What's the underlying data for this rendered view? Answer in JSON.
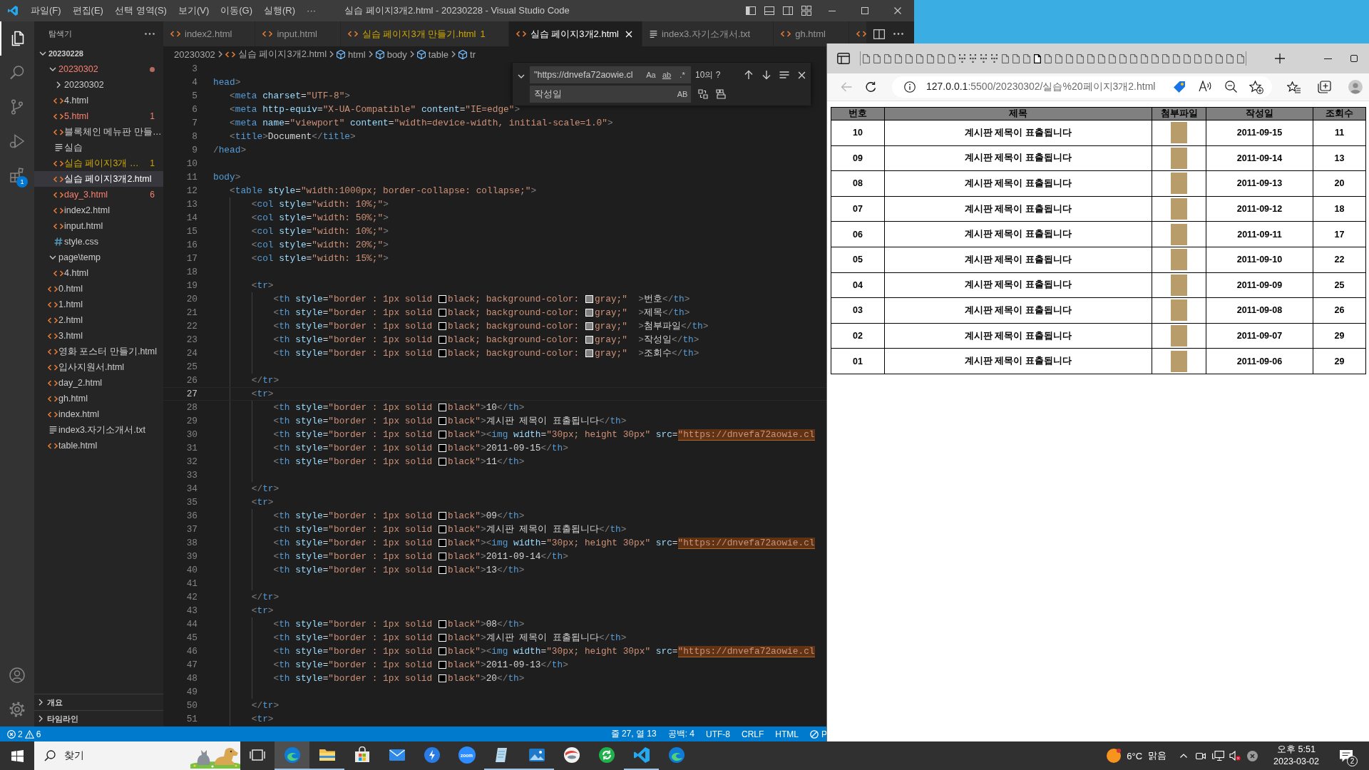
{
  "vscode": {
    "menu": [
      "파일(F)",
      "편집(E)",
      "선택 영역(S)",
      "보기(V)",
      "이동(G)",
      "실행(R)",
      "···"
    ],
    "title": "실습 페이지3개2.html - 20230228 - Visual Studio Code",
    "activity": [
      {
        "kind": "explorer",
        "selected": true
      },
      {
        "kind": "search",
        "selected": false
      },
      {
        "kind": "source-control",
        "selected": false
      },
      {
        "kind": "run",
        "selected": false
      },
      {
        "kind": "extensions",
        "selected": false,
        "badge": "1"
      }
    ],
    "activity_bottom": [
      {
        "kind": "account"
      },
      {
        "kind": "settings"
      }
    ],
    "sidebar": {
      "title": "탐색기",
      "tree": [
        {
          "label": "20230228",
          "kind": "root",
          "expanded": true,
          "selected": false,
          "error": false,
          "warning": false,
          "children": [
            {
              "label": "20230302",
              "kind": "folder",
              "expanded": true,
              "selected": false,
              "error": true,
              "warning": false,
              "children": [
                {
                  "label": "20230302",
                  "kind": "folder",
                  "expanded": false,
                  "selected": false,
                  "error": false,
                  "warning": false
                },
                {
                  "label": "4.html",
                  "kind": "html",
                  "selected": false,
                  "error": false,
                  "warning": false
                },
                {
                  "label": "5.html",
                  "kind": "html",
                  "selected": false,
                  "error": true,
                  "warning": false,
                  "badge": "1"
                },
                {
                  "label": "블록체인 메뉴판 만들…",
                  "kind": "html",
                  "selected": false,
                  "error": false,
                  "warning": false
                },
                {
                  "label": "실습",
                  "kind": "text",
                  "selected": false,
                  "error": false,
                  "warning": false
                },
                {
                  "label": "실습 페이지3개 …",
                  "kind": "html",
                  "selected": false,
                  "error": false,
                  "warning": true,
                  "badge": "1"
                },
                {
                  "label": "실습 페이지3개2.html",
                  "kind": "html",
                  "selected": true,
                  "error": false,
                  "warning": false
                },
                {
                  "label": "day_3.html",
                  "kind": "html",
                  "selected": false,
                  "error": true,
                  "warning": false,
                  "badge": "6"
                },
                {
                  "label": "index2.html",
                  "kind": "html",
                  "selected": false,
                  "error": false,
                  "warning": false
                },
                {
                  "label": "input.html",
                  "kind": "html",
                  "selected": false,
                  "error": false,
                  "warning": false
                },
                {
                  "label": "style.css",
                  "kind": "css",
                  "selected": false,
                  "error": false,
                  "warning": false
                }
              ]
            },
            {
              "label": "page\\temp",
              "kind": "folder",
              "expanded": true,
              "selected": false,
              "error": false,
              "warning": false,
              "children": [
                {
                  "label": "4.html",
                  "kind": "html",
                  "selected": false,
                  "error": false,
                  "warning": false
                }
              ]
            },
            {
              "label": "0.html",
              "kind": "html",
              "selected": false,
              "error": false,
              "warning": false
            },
            {
              "label": "1.html",
              "kind": "html",
              "selected": false,
              "error": false,
              "warning": false
            },
            {
              "label": "2.html",
              "kind": "html",
              "selected": false,
              "error": false,
              "warning": false
            },
            {
              "label": "3.html",
              "kind": "html",
              "selected": false,
              "error": false,
              "warning": false
            },
            {
              "label": "영화 포스터 만들기.html",
              "kind": "html",
              "selected": false,
              "error": false,
              "warning": false
            },
            {
              "label": "입사지원서.html",
              "kind": "html",
              "selected": false,
              "error": false,
              "warning": false
            },
            {
              "label": "day_2.html",
              "kind": "html",
              "selected": false,
              "error": false,
              "warning": false
            },
            {
              "label": "gh.html",
              "kind": "html",
              "selected": false,
              "error": false,
              "warning": false
            },
            {
              "label": "index.html",
              "kind": "html",
              "selected": false,
              "error": false,
              "warning": false
            },
            {
              "label": "index3.자기소개서.txt",
              "kind": "text",
              "selected": false,
              "error": false,
              "warning": false
            },
            {
              "label": "table.html",
              "kind": "html",
              "selected": false,
              "error": false,
              "warning": false
            }
          ]
        }
      ],
      "sections": [
        {
          "label": "개요",
          "expanded": false
        },
        {
          "label": "타임라인",
          "expanded": false
        }
      ]
    },
    "tabs": [
      {
        "label": "index2.html",
        "kind": "html",
        "selected": false,
        "error": false,
        "warning": false
      },
      {
        "label": "input.html",
        "kind": "html",
        "selected": false,
        "error": false,
        "warning": false
      },
      {
        "label": "실습 페이지3개 만들기.html",
        "kind": "html",
        "selected": false,
        "error": false,
        "warning": true,
        "badge": "1"
      },
      {
        "label": "실습 페이지3개2.html",
        "kind": "html",
        "selected": true,
        "error": false,
        "warning": false
      },
      {
        "label": "index3.자기소개서.txt",
        "kind": "text",
        "selected": false,
        "error": false,
        "warning": false
      },
      {
        "label": "gh.html",
        "kind": "html",
        "selected": false,
        "error": false,
        "warning": false
      },
      {
        "kind": "html",
        "selected": false
      }
    ],
    "breadcrumbs": [
      {
        "label": "20230302",
        "kind": "folder"
      },
      {
        "label": "실습 페이지3개2.html",
        "kind": "html"
      },
      {
        "label": "html",
        "kind": "element"
      },
      {
        "label": "body",
        "kind": "element"
      },
      {
        "label": "table",
        "kind": "element"
      },
      {
        "label": "tr",
        "kind": "element"
      }
    ],
    "find": {
      "replace_expanded": true,
      "query": "\"https://dnvefa72aowie.cl",
      "options": [
        {
          "kind": "case",
          "label": "Aa",
          "selected": false
        },
        {
          "kind": "word",
          "label": "ab",
          "selected": false
        },
        {
          "kind": "regex",
          "label": ".*",
          "selected": false
        }
      ],
      "count": "10의 ?",
      "replace": "작성일",
      "preserve_case": {
        "label": "AB",
        "selected": false
      }
    },
    "code": {
      "lines": [
        {
          "number": "3",
          "current": false
        },
        {
          "number": "4",
          "current": false,
          "parts": [
            {
              "kind": "code",
              "text": "head>"
            }
          ]
        },
        {
          "number": "5",
          "current": false,
          "parts": [
            {
              "kind": "code",
              "text": "   <meta charset=\"UTF-8\">"
            }
          ]
        },
        {
          "number": "6",
          "current": false,
          "parts": [
            {
              "kind": "code",
              "text": "   <meta http-equiv=\"X-UA-Compatible\" content=\"IE=edge\">"
            }
          ]
        },
        {
          "number": "7",
          "current": false,
          "parts": [
            {
              "kind": "code",
              "text": "   <meta name=\"viewport\" content=\"width=device-width, initial-scale=1.0\">"
            }
          ]
        },
        {
          "number": "8",
          "current": false,
          "parts": [
            {
              "kind": "code",
              "text": "   <title>Document</title>"
            }
          ]
        },
        {
          "number": "9",
          "current": false,
          "parts": [
            {
              "kind": "code",
              "text": "/head>"
            }
          ]
        },
        {
          "number": "10",
          "current": false
        },
        {
          "number": "11",
          "current": false,
          "parts": [
            {
              "kind": "code",
              "text": "body>"
            }
          ]
        },
        {
          "number": "12",
          "current": false,
          "parts": [
            {
              "kind": "code",
              "text": "   <table style=\"width:1000px; border-collapse: collapse;\">"
            }
          ]
        },
        {
          "number": "13",
          "current": false,
          "parts": [
            {
              "kind": "code",
              "text": "       <col style=\"width: 10%;\">"
            }
          ]
        },
        {
          "number": "14",
          "current": false,
          "parts": [
            {
              "kind": "code",
              "text": "       <col style=\"width: 50%;\">"
            }
          ]
        },
        {
          "number": "15",
          "current": false,
          "parts": [
            {
              "kind": "code",
              "text": "       <col style=\"width: 10%;\">"
            }
          ]
        },
        {
          "number": "16",
          "current": false,
          "parts": [
            {
              "kind": "code",
              "text": "       <col style=\"width: 20%;\">"
            }
          ]
        },
        {
          "number": "17",
          "current": false,
          "parts": [
            {
              "kind": "code",
              "text": "       <col style=\"width: 15%;\">"
            }
          ]
        },
        {
          "number": "18",
          "current": false
        },
        {
          "number": "19",
          "current": false,
          "parts": [
            {
              "kind": "code",
              "text": "       <tr>"
            }
          ]
        },
        {
          "number": "20",
          "current": false,
          "parts": [
            {
              "kind": "code",
              "text": "           <th style=\"border : 1px solid "
            },
            {
              "kind": "swatch",
              "color": "#000000"
            },
            {
              "kind": "code",
              "text": "black; background-color: "
            },
            {
              "kind": "swatch",
              "color": "#808080"
            },
            {
              "kind": "code",
              "text": "gray;\"  >번호</th>"
            }
          ]
        },
        {
          "number": "21",
          "current": false,
          "parts": [
            {
              "kind": "code",
              "text": "           <th style=\"border : 1px solid "
            },
            {
              "kind": "swatch",
              "color": "#000000"
            },
            {
              "kind": "code",
              "text": "black; background-color: "
            },
            {
              "kind": "swatch",
              "color": "#808080"
            },
            {
              "kind": "code",
              "text": "gray;\"  >제목</th>"
            }
          ]
        },
        {
          "number": "22",
          "current": false,
          "parts": [
            {
              "kind": "code",
              "text": "           <th style=\"border : 1px solid "
            },
            {
              "kind": "swatch",
              "color": "#000000"
            },
            {
              "kind": "code",
              "text": "black; background-color: "
            },
            {
              "kind": "swatch",
              "color": "#808080"
            },
            {
              "kind": "code",
              "text": "gray;\"  >첨부파일</th>"
            }
          ]
        },
        {
          "number": "23",
          "current": false,
          "parts": [
            {
              "kind": "code",
              "text": "           <th style=\"border : 1px solid "
            },
            {
              "kind": "swatch",
              "color": "#000000"
            },
            {
              "kind": "code",
              "text": "black; background-color: "
            },
            {
              "kind": "swatch",
              "color": "#808080"
            },
            {
              "kind": "code",
              "text": "gray;\"  >작성일</th>"
            }
          ]
        },
        {
          "number": "24",
          "current": false,
          "parts": [
            {
              "kind": "code",
              "text": "           <th style=\"border : 1px solid "
            },
            {
              "kind": "swatch",
              "color": "#000000"
            },
            {
              "kind": "code",
              "text": "black; background-color: "
            },
            {
              "kind": "swatch",
              "color": "#808080"
            },
            {
              "kind": "code",
              "text": "gray;\"  >조회수</th>"
            }
          ]
        },
        {
          "number": "25",
          "current": false
        },
        {
          "number": "26",
          "current": false,
          "parts": [
            {
              "kind": "code",
              "text": "       </tr>"
            }
          ]
        },
        {
          "number": "27",
          "current": true,
          "parts": [
            {
              "kind": "code",
              "text": "       <tr>"
            }
          ]
        },
        {
          "number": "28",
          "current": false,
          "parts": [
            {
              "kind": "code",
              "text": "           <th style=\"border : 1px solid "
            },
            {
              "kind": "swatch",
              "color": "#000000"
            },
            {
              "kind": "code",
              "text": "black\">10</th>"
            }
          ]
        },
        {
          "number": "29",
          "current": false,
          "parts": [
            {
              "kind": "code",
              "text": "           <th style=\"border : 1px solid "
            },
            {
              "kind": "swatch",
              "color": "#000000"
            },
            {
              "kind": "code",
              "text": "black\">계시판 제목이 표출됩니다</th>"
            }
          ]
        },
        {
          "number": "30",
          "current": false,
          "parts": [
            {
              "kind": "code",
              "text": "           <th style=\"border : 1px solid "
            },
            {
              "kind": "swatch",
              "color": "#000000"
            },
            {
              "kind": "code",
              "text": "black\"><img width=\"30px; height 30px\" src="
            },
            {
              "kind": "match",
              "text": "\"https://dnvefa72aowie.cl"
            }
          ]
        },
        {
          "number": "31",
          "current": false,
          "parts": [
            {
              "kind": "code",
              "text": "           <th style=\"border : 1px solid "
            },
            {
              "kind": "swatch",
              "color": "#000000"
            },
            {
              "kind": "code",
              "text": "black\">2011-09-15</th>"
            }
          ]
        },
        {
          "number": "32",
          "current": false,
          "parts": [
            {
              "kind": "code",
              "text": "           <th style=\"border : 1px solid "
            },
            {
              "kind": "swatch",
              "color": "#000000"
            },
            {
              "kind": "code",
              "text": "black\">11</th>"
            }
          ]
        },
        {
          "number": "33",
          "current": false
        },
        {
          "number": "34",
          "current": false,
          "parts": [
            {
              "kind": "code",
              "text": "       </tr>"
            }
          ]
        },
        {
          "number": "35",
          "current": false,
          "parts": [
            {
              "kind": "code",
              "text": "       <tr>"
            }
          ]
        },
        {
          "number": "36",
          "current": false,
          "parts": [
            {
              "kind": "code",
              "text": "           <th style=\"border : 1px solid "
            },
            {
              "kind": "swatch",
              "color": "#000000"
            },
            {
              "kind": "code",
              "text": "black\">09</th>"
            }
          ]
        },
        {
          "number": "37",
          "current": false,
          "parts": [
            {
              "kind": "code",
              "text": "           <th style=\"border : 1px solid "
            },
            {
              "kind": "swatch",
              "color": "#000000"
            },
            {
              "kind": "code",
              "text": "black\">계시판 제목이 표출됩니다</th>"
            }
          ]
        },
        {
          "number": "38",
          "current": false,
          "parts": [
            {
              "kind": "code",
              "text": "           <th style=\"border : 1px solid "
            },
            {
              "kind": "swatch",
              "color": "#000000"
            },
            {
              "kind": "code",
              "text": "black\"><img width=\"30px; height 30px\" src="
            },
            {
              "kind": "match",
              "text": "\"https://dnvefa72aowie.cl"
            }
          ]
        },
        {
          "number": "39",
          "current": false,
          "parts": [
            {
              "kind": "code",
              "text": "           <th style=\"border : 1px solid "
            },
            {
              "kind": "swatch",
              "color": "#000000"
            },
            {
              "kind": "code",
              "text": "black\">2011-09-14</th>"
            }
          ]
        },
        {
          "number": "40",
          "current": false,
          "parts": [
            {
              "kind": "code",
              "text": "           <th style=\"border : 1px solid "
            },
            {
              "kind": "swatch",
              "color": "#000000"
            },
            {
              "kind": "code",
              "text": "black\">13</th>"
            }
          ]
        },
        {
          "number": "41",
          "current": false
        },
        {
          "number": "42",
          "current": false,
          "parts": [
            {
              "kind": "code",
              "text": "       </tr>"
            }
          ]
        },
        {
          "number": "43",
          "current": false,
          "parts": [
            {
              "kind": "code",
              "text": "       <tr>"
            }
          ]
        },
        {
          "number": "44",
          "current": false,
          "parts": [
            {
              "kind": "code",
              "text": "           <th style=\"border : 1px solid "
            },
            {
              "kind": "swatch",
              "color": "#000000"
            },
            {
              "kind": "code",
              "text": "black\">08</th>"
            }
          ]
        },
        {
          "number": "45",
          "current": false,
          "parts": [
            {
              "kind": "code",
              "text": "           <th style=\"border : 1px solid "
            },
            {
              "kind": "swatch",
              "color": "#000000"
            },
            {
              "kind": "code",
              "text": "black\">계시판 제목이 표출됩니다</th>"
            }
          ]
        },
        {
          "number": "46",
          "current": false,
          "parts": [
            {
              "kind": "code",
              "text": "           <th style=\"border : 1px solid "
            },
            {
              "kind": "swatch",
              "color": "#000000"
            },
            {
              "kind": "code",
              "text": "black\"><img width=\"30px; height 30px\" src="
            },
            {
              "kind": "match",
              "text": "\"https://dnvefa72aowie.cl"
            }
          ]
        },
        {
          "number": "47",
          "current": false,
          "parts": [
            {
              "kind": "code",
              "text": "           <th style=\"border : 1px solid "
            },
            {
              "kind": "swatch",
              "color": "#000000"
            },
            {
              "kind": "code",
              "text": "black\">2011-09-13</th>"
            }
          ]
        },
        {
          "number": "48",
          "current": false,
          "parts": [
            {
              "kind": "code",
              "text": "           <th style=\"border : 1px solid "
            },
            {
              "kind": "swatch",
              "color": "#000000"
            },
            {
              "kind": "code",
              "text": "black\">20</th>"
            }
          ]
        },
        {
          "number": "49",
          "current": false
        },
        {
          "number": "50",
          "current": false,
          "parts": [
            {
              "kind": "code",
              "text": "       </tr>"
            }
          ]
        },
        {
          "number": "51",
          "current": false,
          "parts": [
            {
              "kind": "code",
              "text": "       <tr>"
            }
          ]
        }
      ]
    },
    "status_bar": {
      "errors": "2",
      "warnings": "6",
      "items": [
        "줄 27, 열 13",
        "공백: 4",
        "UTF-8",
        "CRLF",
        "HTML"
      ],
      "last": "P"
    }
  },
  "browser": {
    "tabs": [
      {
        "kind": "page",
        "selected": false
      },
      {
        "kind": "page",
        "selected": false
      },
      {
        "kind": "page",
        "selected": false
      },
      {
        "kind": "page",
        "selected": false
      },
      {
        "kind": "page",
        "selected": false
      },
      {
        "kind": "page",
        "selected": false
      },
      {
        "kind": "page",
        "selected": false
      },
      {
        "kind": "page",
        "selected": false
      },
      {
        "kind": "page",
        "selected": false
      },
      {
        "kind": "dotted",
        "selected": false
      },
      {
        "kind": "dotted",
        "selected": false
      },
      {
        "kind": "dotted",
        "selected": false
      },
      {
        "kind": "dotted",
        "selected": false
      },
      {
        "kind": "page",
        "selected": false
      },
      {
        "kind": "page",
        "selected": false
      },
      {
        "kind": "page",
        "selected": false
      },
      {
        "kind": "page",
        "selected": true
      },
      {
        "kind": "page",
        "selected": false
      },
      {
        "kind": "page",
        "selected": false
      },
      {
        "kind": "page",
        "selected": false
      },
      {
        "kind": "page",
        "selected": false
      },
      {
        "kind": "page",
        "selected": false
      },
      {
        "kind": "page",
        "selected": false
      },
      {
        "kind": "page",
        "selected": false
      },
      {
        "kind": "page",
        "selected": false
      },
      {
        "kind": "page",
        "selected": false
      },
      {
        "kind": "page",
        "selected": false
      },
      {
        "kind": "page",
        "selected": false
      },
      {
        "kind": "page",
        "selected": false
      },
      {
        "kind": "page",
        "selected": false
      },
      {
        "kind": "page",
        "selected": false
      },
      {
        "kind": "page",
        "selected": false
      },
      {
        "kind": "page",
        "selected": false
      },
      {
        "kind": "page",
        "selected": false
      },
      {
        "kind": "page",
        "selected": false
      },
      {
        "kind": "page",
        "selected": false
      }
    ],
    "back": {
      "disabled": true
    },
    "url": {
      "host": "127.0.0.1",
      "path": ":5500/20230302/실습%20페이지3개2.html"
    },
    "table": {
      "columns": [
        "번호",
        "제목",
        "첨부파일",
        "작성일",
        "조회수"
      ],
      "rows": [
        {
          "number": "10",
          "title": "계시판 제목이 표출됩니다",
          "date": "2011-09-15",
          "views": "11"
        },
        {
          "number": "09",
          "title": "계시판 제목이 표출됩니다",
          "date": "2011-09-14",
          "views": "13"
        },
        {
          "number": "08",
          "title": "계시판 제목이 표출됩니다",
          "date": "2011-09-13",
          "views": "20"
        },
        {
          "number": "07",
          "title": "계시판 제목이 표출됩니다",
          "date": "2011-09-12",
          "views": "18"
        },
        {
          "number": "06",
          "title": "계시판 제목이 표출됩니다",
          "date": "2011-09-11",
          "views": "17"
        },
        {
          "number": "05",
          "title": "계시판 제목이 표출됩니다",
          "date": "2011-09-10",
          "views": "22"
        },
        {
          "number": "04",
          "title": "계시판 제목이 표출됩니다",
          "date": "2011-09-09",
          "views": "25"
        },
        {
          "number": "03",
          "title": "계시판 제목이 표출됩니다",
          "date": "2011-09-08",
          "views": "26"
        },
        {
          "number": "02",
          "title": "계시판 제목이 표출됩니다",
          "date": "2011-09-07",
          "views": "29"
        },
        {
          "number": "01",
          "title": "계시판 제목이 표출됩니다",
          "date": "2011-09-06",
          "views": "29"
        }
      ]
    }
  },
  "taskbar": {
    "search": {
      "placeholder": "찾기"
    },
    "apps": [
      {
        "kind": "task-view",
        "selected": false,
        "running": false
      },
      {
        "kind": "browser",
        "selected": true,
        "running": true
      },
      {
        "kind": "files",
        "selected": false,
        "running": true
      },
      {
        "kind": "store",
        "selected": false,
        "running": false
      },
      {
        "kind": "mail",
        "selected": false,
        "running": false
      },
      {
        "kind": "arrow",
        "selected": false,
        "running": false
      },
      {
        "kind": "video",
        "label": "zoom",
        "selected": false,
        "running": false
      },
      {
        "kind": "notes",
        "selected": false,
        "running": true
      },
      {
        "kind": "photos",
        "selected": false,
        "running": true
      },
      {
        "kind": "globe",
        "selected": false,
        "running": false
      },
      {
        "kind": "sync",
        "selected": false,
        "running": false
      },
      {
        "kind": "editor",
        "selected": false,
        "running": true
      },
      {
        "kind": "browser",
        "selected": false,
        "running": false
      }
    ],
    "weather": {
      "temperature": "6°C",
      "condition": "맑음"
    },
    "tray": [
      {
        "kind": "chevron"
      },
      {
        "kind": "meet"
      },
      {
        "kind": "network"
      },
      {
        "kind": "muted"
      },
      {
        "kind": "shield"
      }
    ],
    "clock": {
      "time": "오후 5:51",
      "date": "2023-03-02"
    },
    "notifications": "2"
  }
}
